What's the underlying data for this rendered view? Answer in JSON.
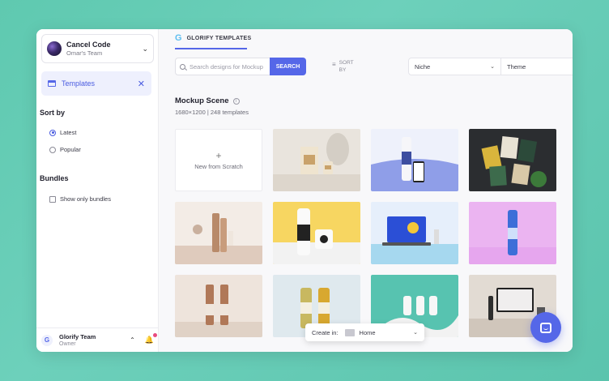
{
  "account": {
    "name": "Cancel Code",
    "team": "Omar's Team"
  },
  "sidebar": {
    "templates_label": "Templates",
    "sort_title": "Sort by",
    "sort_options": [
      {
        "label": "Latest",
        "selected": true
      },
      {
        "label": "Popular",
        "selected": false
      }
    ],
    "bundles_title": "Bundles",
    "bundles_checkbox": "Show only bundles",
    "footer": {
      "name": "Glorify Team",
      "role": "Owner",
      "logo": "G"
    }
  },
  "header": {
    "brand_letter": "G",
    "brand": "GLORIFY TEMPLATES"
  },
  "search": {
    "placeholder": "Search designs for Mockup",
    "button": "SEARCH"
  },
  "sort": {
    "label": "SORT BY"
  },
  "filters": {
    "niche": "Niche",
    "theme": "Theme"
  },
  "section": {
    "title": "Mockup Scene",
    "subtitle": "1680×1200 | 248 templates"
  },
  "new_tile": {
    "label": "New from Scratch"
  },
  "create_bar": {
    "label": "Create in:",
    "value": "Home"
  },
  "colors": {
    "accent": "#5567e8",
    "background": "#63ccb5"
  }
}
